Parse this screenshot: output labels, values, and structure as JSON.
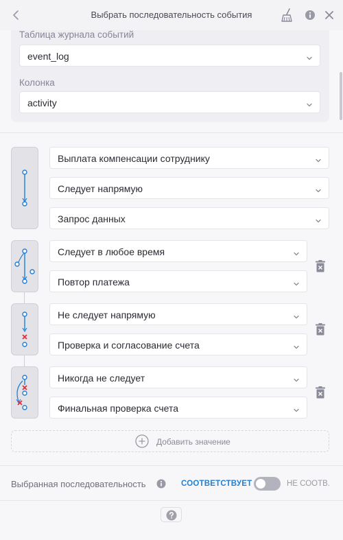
{
  "header": {
    "title": "Выбрать последовательность события"
  },
  "config": {
    "table_label": "Таблица журнала событий",
    "table_value": "event_log",
    "column_label": "Колонка",
    "column_value": "activity"
  },
  "sequence": {
    "first": {
      "start_activity": "Выплата компенсации сотруднику",
      "relation": "Следует напрямую",
      "end_activity": "Запрос данных"
    },
    "steps": [
      {
        "relation": "Следует в любое время",
        "activity": "Повтор платежа"
      },
      {
        "relation": "Не следует напрямую",
        "activity": "Проверка и согласование счета"
      },
      {
        "relation": "Никогда не следует",
        "activity": "Финальная проверка счета"
      }
    ],
    "add_label": "Добавить значение"
  },
  "footer": {
    "selected_label": "Выбранная последовательность",
    "match_label": "СООТВЕТСТВУЕТ",
    "nomatch_label": "НЕ СООТВ."
  },
  "colors": {
    "accent": "#1f7fd8",
    "node_blue": "#1f7fd8",
    "cross_red": "#e0313d"
  }
}
